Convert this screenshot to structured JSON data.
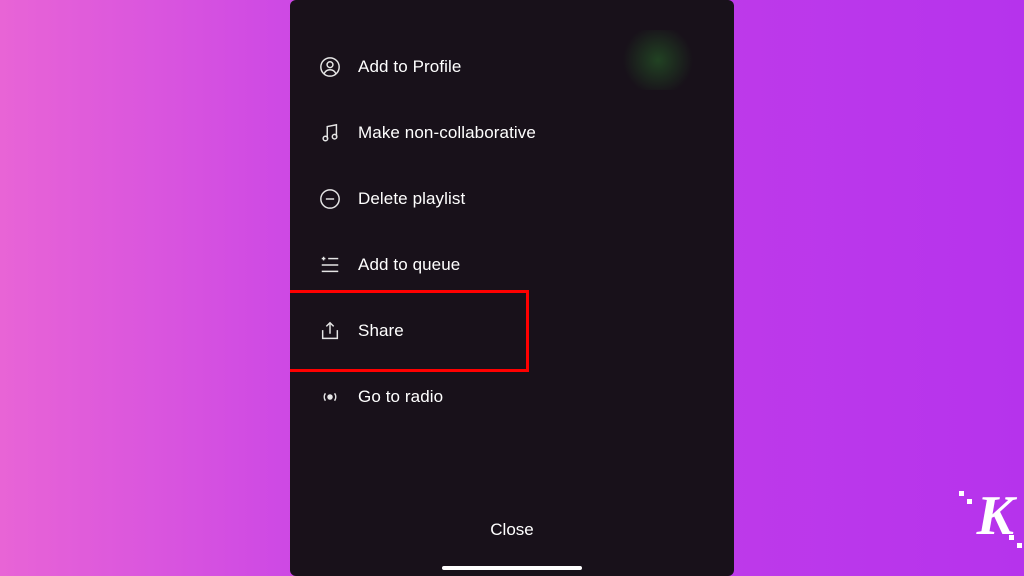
{
  "menu": {
    "items": [
      {
        "label": "Add to Profile"
      },
      {
        "label": "Make non-collaborative"
      },
      {
        "label": "Delete playlist"
      },
      {
        "label": "Add to queue"
      },
      {
        "label": "Share"
      },
      {
        "label": "Go to radio"
      }
    ]
  },
  "close_label": "Close",
  "watermark": "K",
  "highlighted_item_index": 4
}
